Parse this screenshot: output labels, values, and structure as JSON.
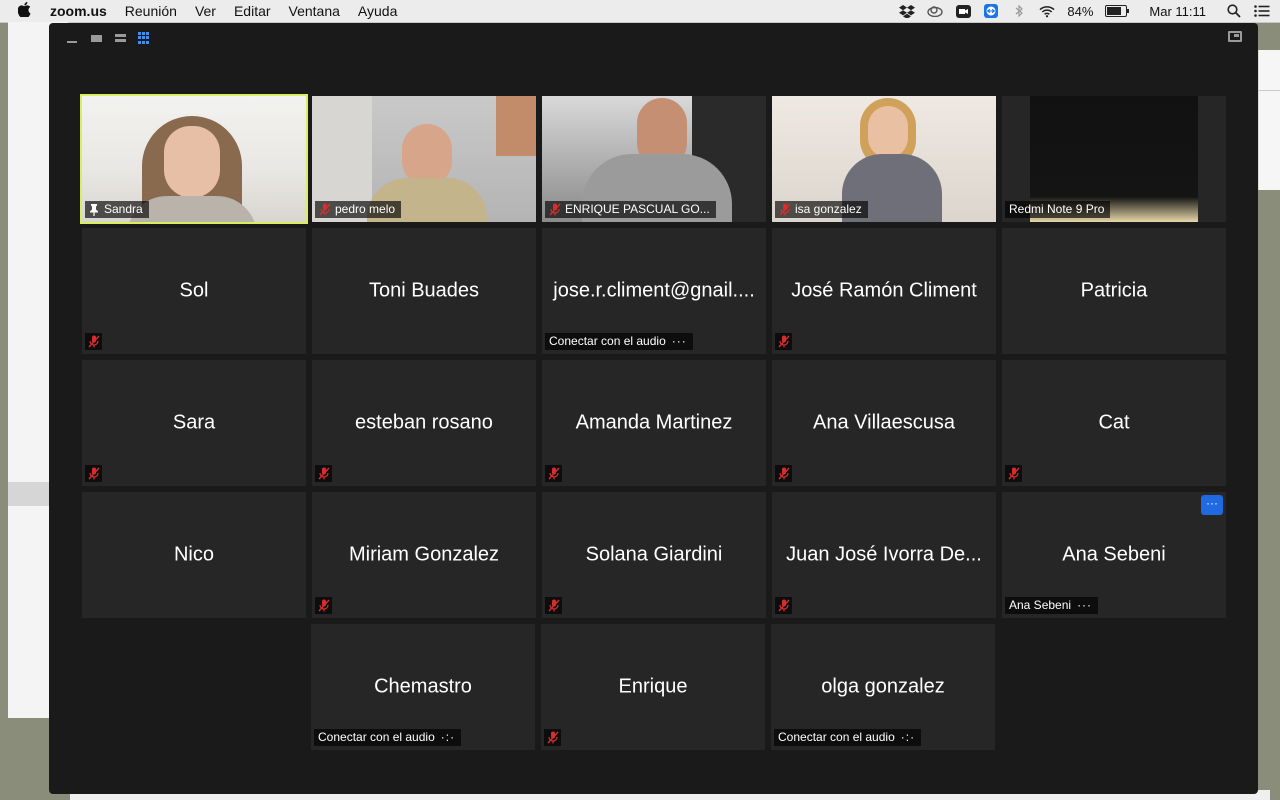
{
  "menubar": {
    "app_name": "zoom.us",
    "menus": [
      "Reunión",
      "Ver",
      "Editar",
      "Ventana",
      "Ayuda"
    ],
    "battery": "84%",
    "battery_level": 0.84,
    "clock": "Mar 11:11"
  },
  "toolbar": {
    "active_view": "gallery"
  },
  "tiles": [
    {
      "name": "Sandra",
      "video": true,
      "pinned": true,
      "active_speaker": true
    },
    {
      "name": "pedro melo",
      "video": true,
      "muted": true
    },
    {
      "name": "ENRIQUE PASCUAL GO...",
      "video": true,
      "muted": true
    },
    {
      "name": "isa gonzalez",
      "video": true,
      "muted": true
    },
    {
      "name": "Redmi Note 9 Pro",
      "video": true
    },
    {
      "name": "Sol",
      "muted": true
    },
    {
      "name": "Toni Buades"
    },
    {
      "name": "jose.r.climent@gnail....",
      "audio_label": "Conectar con el audio",
      "more": "···"
    },
    {
      "name": "José Ramón Climent",
      "muted": true
    },
    {
      "name": "Patricia"
    },
    {
      "name": "Sara",
      "muted": true
    },
    {
      "name": "esteban rosano",
      "muted": true
    },
    {
      "name": "Amanda Martinez",
      "muted": true
    },
    {
      "name": "Ana Villaescusa",
      "muted": true
    },
    {
      "name": "Cat",
      "muted": true
    },
    {
      "name": "Nico"
    },
    {
      "name": "Miriam Gonzalez",
      "muted": true
    },
    {
      "name": "Solana Giardini",
      "muted": true
    },
    {
      "name": "Juan José Ivorra De...",
      "muted": true
    },
    {
      "name": "Ana Sebeni",
      "audio_label": "Ana Sebeni",
      "more": "···",
      "blue_more": "···"
    },
    {
      "name": "Chemastro",
      "audio_label": "Conectar con el audio",
      "more": "·:·"
    },
    {
      "name": "Enrique",
      "muted": true
    },
    {
      "name": "olga gonzalez",
      "audio_label": "Conectar con el audio",
      "more": "·:·"
    }
  ],
  "colors": {
    "active_speaker_border": "#d8ef62",
    "tile_bg": "#262626",
    "window_bg": "#1a1a1a",
    "mute_red": "#d92d2d",
    "accent_blue": "#1f6ae0"
  }
}
